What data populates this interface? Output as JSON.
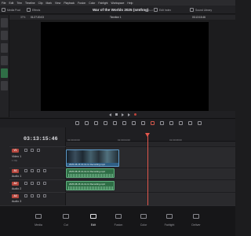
{
  "menu": [
    "File",
    "Edit",
    "Trim",
    "Timeline",
    "Clip",
    "Mark",
    "View",
    "Playback",
    "Fusion",
    "Color",
    "Fairlight",
    "Workspace",
    "Help"
  ],
  "toolbar": {
    "media_pool_label": "Media Pool",
    "effects_label": "Effects",
    "edit_index_label": "Edit Index",
    "sound_library_label": "Sound Library"
  },
  "project": {
    "title": "War of the Worlds 2025 (smthng)",
    "edited_label": "Edited"
  },
  "viewer": {
    "zoom": "37%",
    "source_timecode": "01:27:20:03",
    "timeline_name": "Timeline 1",
    "record_timecode": "03:13:15:46"
  },
  "timeline": {
    "current_timecode": "03:13:15:46",
    "ruler": [
      "01:00:00:00",
      "01:00:04:00",
      "01:00:08:00"
    ],
    "tracks": [
      {
        "badge": "V1",
        "name": "Video 1",
        "sub": "1 Clip"
      },
      {
        "badge": "A1",
        "name": "Audio 1",
        "sub": "2.0"
      },
      {
        "badge": "A2",
        "name": "Audio 2",
        "sub": "2.0"
      },
      {
        "badge": "A3",
        "name": "Audio 3",
        "sub": "2.0"
      }
    ],
    "clips": {
      "video": "2025-08-15 21-12-11 Recording.mp4",
      "audio1": "2025-08-15 21-12-11 Recording.mp4",
      "audio2": "2025-08-15 21-12-11 Recording.mp4"
    }
  },
  "pages": [
    {
      "label": "Media",
      "active": false
    },
    {
      "label": "Cut",
      "active": false
    },
    {
      "label": "Edit",
      "active": true
    },
    {
      "label": "Fusion",
      "active": false
    },
    {
      "label": "Color",
      "active": false
    },
    {
      "label": "Fairlight",
      "active": false
    },
    {
      "label": "Deliver",
      "active": false
    }
  ],
  "colors": {
    "clip_video": "#2f5e84",
    "clip_audio": "#2f6e46",
    "playhead": "#e2574c",
    "track_badge": "#b6463d"
  }
}
